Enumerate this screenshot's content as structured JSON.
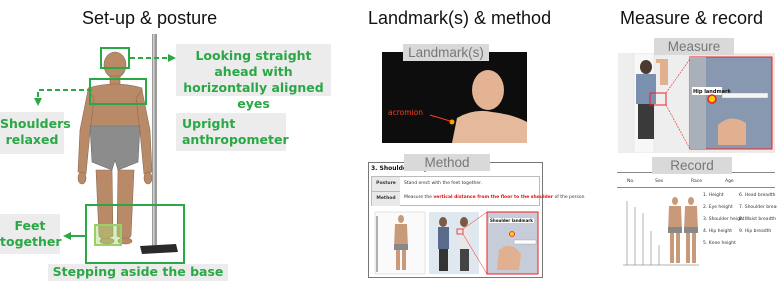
{
  "panels": {
    "setup": {
      "title": "Set-up & posture"
    },
    "landmark": {
      "title": "Landmark(s) & method"
    },
    "measure": {
      "title": "Measure & record"
    }
  },
  "setup": {
    "label_eyes": "Looking straight ahead with horizontally aligned eyes",
    "label_shoulders": "Shoulders relaxed",
    "label_anthropometer": "Upright anthropometer",
    "label_feet": "Feet together",
    "label_base": "Stepping aside the base"
  },
  "landmark_panel": {
    "landmarks_caption": "Landmark(s)",
    "acromion_label": "acromion",
    "method_caption": "Method",
    "card_title": "3. Shoulder Height",
    "posture_key": "Posture",
    "posture_value": "Stand erect with the feet together.",
    "method_key": "Method",
    "method_value_pre": "Measure the ",
    "method_value_bold": "vertical distance from the floor to the shoulder",
    "method_value_post": " of the person",
    "shoulder_landmark": "Shoulder landmark"
  },
  "measure_panel": {
    "measure_caption": "Measure",
    "hip_landmark": "Hip landmark",
    "record_caption": "Record",
    "table_headers": [
      "No.",
      "Sex",
      "Race",
      "Age"
    ],
    "items_left": [
      "1. Height",
      "2. Eye height",
      "3. Shoulder height",
      "4. Hip height",
      "5. Knee height"
    ],
    "items_right": [
      "6. Head breadth",
      "7. Shoulder breadth",
      "8. Waist breadth",
      "9. Hip breadth"
    ]
  }
}
